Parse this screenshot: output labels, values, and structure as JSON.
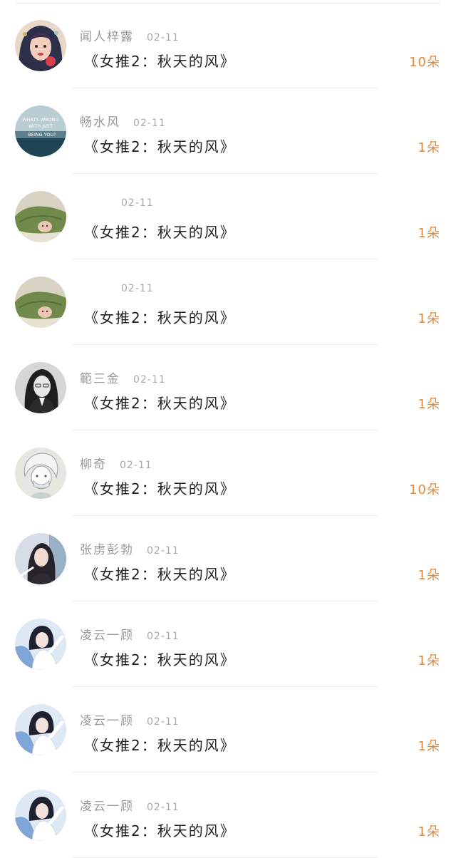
{
  "colors": {
    "accent": "#e0893c",
    "name": "#9a9a9a",
    "title": "#1f1f1f",
    "divider": "#ededed"
  },
  "entries": [
    {
      "username": "闻人梓露",
      "date": "02-11",
      "title": "《女推2：秋天的风》",
      "amount": "10朵",
      "avatar": "illustrated-girl-avatar"
    },
    {
      "username": "畅水风",
      "date": "02-11",
      "title": "《女推2：秋天的风》",
      "amount": "1朵",
      "avatar": "ocean-text-avatar",
      "avatar_text": [
        "WHATS WRONG",
        "WITH JUST",
        "BEING YOU?"
      ]
    },
    {
      "username": "",
      "date": "02-11",
      "title": "《女推2：秋天的风》",
      "amount": "1朵",
      "avatar": "baby-green-blanket-avatar"
    },
    {
      "username": "",
      "date": "02-11",
      "title": "《女推2：秋天的风》",
      "amount": "1朵",
      "avatar": "baby-green-blanket-avatar"
    },
    {
      "username": "範三金",
      "date": "02-11",
      "title": "《女推2：秋天的风》",
      "amount": "1朵",
      "avatar": "bw-portrait-avatar"
    },
    {
      "username": "柳奇",
      "date": "02-11",
      "title": "《女推2：秋天的风》",
      "amount": "10朵",
      "avatar": "anime-boy-avatar"
    },
    {
      "username": "张虏彭勃",
      "date": "02-11",
      "title": "《女推2：秋天的风》",
      "amount": "1朵",
      "avatar": "girl-dark-hair-avatar"
    },
    {
      "username": "凌云一顾",
      "date": "02-11",
      "title": "《女推2：秋天的风》",
      "amount": "1朵",
      "avatar": "girl-blue-white-avatar"
    },
    {
      "username": "凌云一顾",
      "date": "02-11",
      "title": "《女推2：秋天的风》",
      "amount": "1朵",
      "avatar": "girl-blue-white-avatar"
    },
    {
      "username": "凌云一顾",
      "date": "02-11",
      "title": "《女推2：秋天的风》",
      "amount": "1朵",
      "avatar": "girl-blue-white-avatar"
    }
  ]
}
